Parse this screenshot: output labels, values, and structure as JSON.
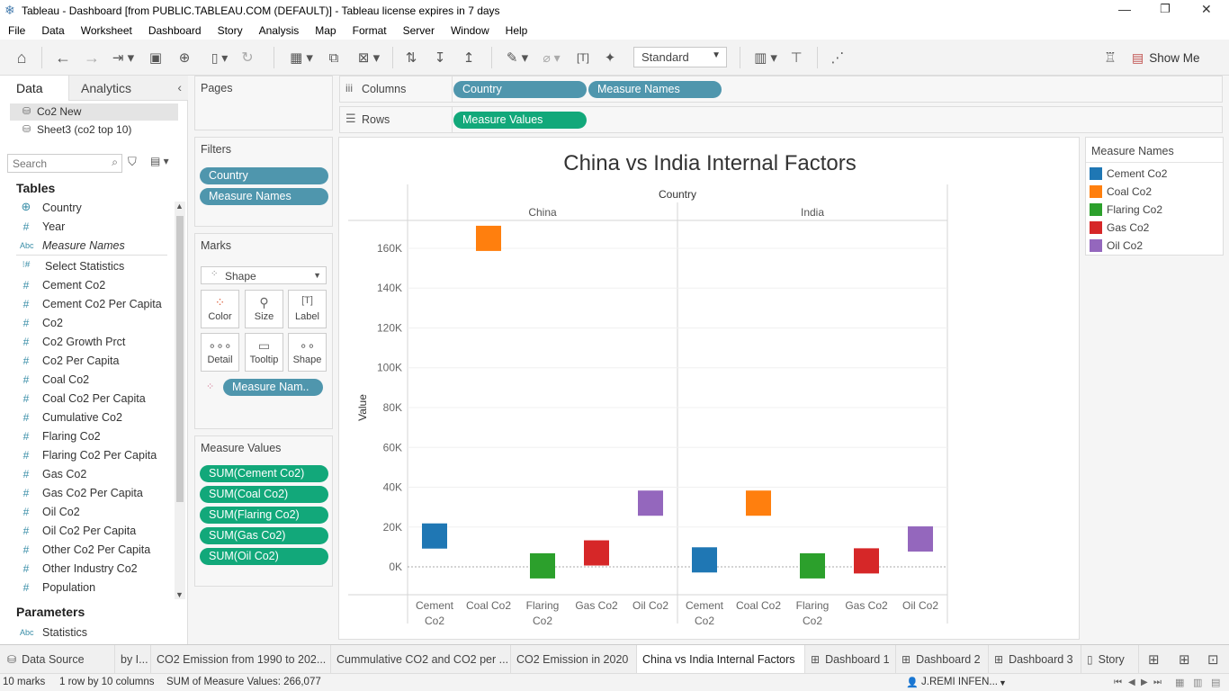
{
  "window": {
    "title": "Tableau - Dashboard [from PUBLIC.TABLEAU.COM (DEFAULT)] - Tableau license expires in 7 days"
  },
  "menu": [
    "File",
    "Data",
    "Worksheet",
    "Dashboard",
    "Story",
    "Analysis",
    "Map",
    "Format",
    "Server",
    "Window",
    "Help"
  ],
  "toolbar": {
    "fit_mode": "Standard",
    "show_me": "Show Me"
  },
  "data_pane": {
    "tabs": [
      "Data",
      "Analytics"
    ],
    "datasources": [
      "Co2 New",
      "Sheet3 (co2 top 10)"
    ],
    "search_placeholder": "Search",
    "tables_title": "Tables",
    "fields": [
      {
        "name": "Country",
        "icon": "globe-icon"
      },
      {
        "name": "Year",
        "icon": "hash-icon"
      },
      {
        "name": "Measure Names",
        "icon": "abc-icon"
      },
      {
        "name": "Select Statistics",
        "icon": "parameter-icon"
      },
      {
        "name": "Cement Co2",
        "icon": "hash-icon"
      },
      {
        "name": "Cement Co2 Per Capita",
        "icon": "hash-icon"
      },
      {
        "name": "Co2",
        "icon": "hash-icon"
      },
      {
        "name": "Co2 Growth Prct",
        "icon": "hash-icon"
      },
      {
        "name": "Co2 Per Capita",
        "icon": "hash-icon"
      },
      {
        "name": "Coal Co2",
        "icon": "hash-icon"
      },
      {
        "name": "Coal Co2 Per Capita",
        "icon": "hash-icon"
      },
      {
        "name": "Cumulative Co2",
        "icon": "hash-icon"
      },
      {
        "name": "Flaring Co2",
        "icon": "hash-icon"
      },
      {
        "name": "Flaring Co2 Per Capita",
        "icon": "hash-icon"
      },
      {
        "name": "Gas Co2",
        "icon": "hash-icon"
      },
      {
        "name": "Gas Co2 Per Capita",
        "icon": "hash-icon"
      },
      {
        "name": "Oil Co2",
        "icon": "hash-icon"
      },
      {
        "name": "Oil Co2 Per Capita",
        "icon": "hash-icon"
      },
      {
        "name": "Other Co2 Per Capita",
        "icon": "hash-icon"
      },
      {
        "name": "Other Industry Co2",
        "icon": "hash-icon"
      },
      {
        "name": "Population",
        "icon": "hash-icon"
      }
    ],
    "parameters_title": "Parameters",
    "parameters": [
      {
        "name": "Statistics",
        "icon": "abc-icon"
      }
    ]
  },
  "pages_card": {
    "title": "Pages"
  },
  "filters_card": {
    "title": "Filters",
    "pills": [
      "Country",
      "Measure Names"
    ]
  },
  "marks_card": {
    "title": "Marks",
    "mark_type": "Shape",
    "buttons": [
      "Color",
      "Size",
      "Label",
      "Detail",
      "Tooltip",
      "Shape"
    ],
    "color_pill": "Measure Nam.."
  },
  "measure_values_card": {
    "title": "Measure Values",
    "pills": [
      "SUM(Cement Co2)",
      "SUM(Coal Co2)",
      "SUM(Flaring Co2)",
      "SUM(Gas Co2)",
      "SUM(Oil Co2)"
    ]
  },
  "shelves": {
    "columns_label": "Columns",
    "columns": [
      "Country",
      "Measure Names"
    ],
    "rows_label": "Rows",
    "rows": [
      "Measure Values"
    ]
  },
  "legend": {
    "title": "Measure Names",
    "items": [
      {
        "label": "Cement Co2",
        "color": "#1f77b4"
      },
      {
        "label": "Coal Co2",
        "color": "#ff7f0e"
      },
      {
        "label": "Flaring Co2",
        "color": "#2ca02c"
      },
      {
        "label": "Gas Co2",
        "color": "#d62728"
      },
      {
        "label": "Oil Co2",
        "color": "#9467bd"
      }
    ]
  },
  "chart_data": {
    "type": "scatter",
    "title": "China vs India Internal Factors",
    "column_header": "Country",
    "panes": [
      "China",
      "India"
    ],
    "categories": [
      "Cement Co2",
      "Coal Co2",
      "Flaring Co2",
      "Gas Co2",
      "Oil Co2"
    ],
    "category_lines": [
      [
        "Cement",
        "Co2"
      ],
      [
        "Coal Co2"
      ],
      [
        "Flaring",
        "Co2"
      ],
      [
        "Gas Co2"
      ],
      [
        "Oil Co2"
      ]
    ],
    "series": [
      {
        "name": "China",
        "values": [
          15500,
          165000,
          500,
          7000,
          32000
        ]
      },
      {
        "name": "India",
        "values": [
          3500,
          32000,
          500,
          3000,
          14000
        ]
      }
    ],
    "ylabel": "Value",
    "ylim": [
      -14000,
      174000
    ],
    "yticks": [
      0,
      20000,
      40000,
      60000,
      80000,
      100000,
      120000,
      140000,
      160000
    ],
    "ytick_labels": [
      "0K",
      "20K",
      "40K",
      "60K",
      "80K",
      "100K",
      "120K",
      "140K",
      "160K"
    ],
    "colors": [
      "#1f77b4",
      "#ff7f0e",
      "#2ca02c",
      "#d62728",
      "#9467bd"
    ]
  },
  "sheet_tabs": [
    {
      "label": "Data Source",
      "icon": "datasource-icon",
      "active": false
    },
    {
      "label": "by I...",
      "icon": "",
      "active": false
    },
    {
      "label": "CO2 Emission from 1990 to 202...",
      "icon": "",
      "active": false
    },
    {
      "label": "Cummulative CO2 and CO2 per ...",
      "icon": "",
      "active": false
    },
    {
      "label": "CO2 Emission in 2020",
      "icon": "",
      "active": false
    },
    {
      "label": "China vs India Internal Factors",
      "icon": "",
      "active": true
    },
    {
      "label": "Dashboard 1",
      "icon": "dashboard-icon",
      "active": false
    },
    {
      "label": "Dashboard 2",
      "icon": "dashboard-icon",
      "active": false
    },
    {
      "label": "Dashboard 3",
      "icon": "dashboard-icon",
      "active": false
    },
    {
      "label": "Story",
      "icon": "story-icon",
      "active": false
    }
  ],
  "status": {
    "marks": "10 marks",
    "dims": "1 row by 10 columns",
    "sum": "SUM of Measure Values: 266,077",
    "user": "J.REMI INFEN..."
  }
}
